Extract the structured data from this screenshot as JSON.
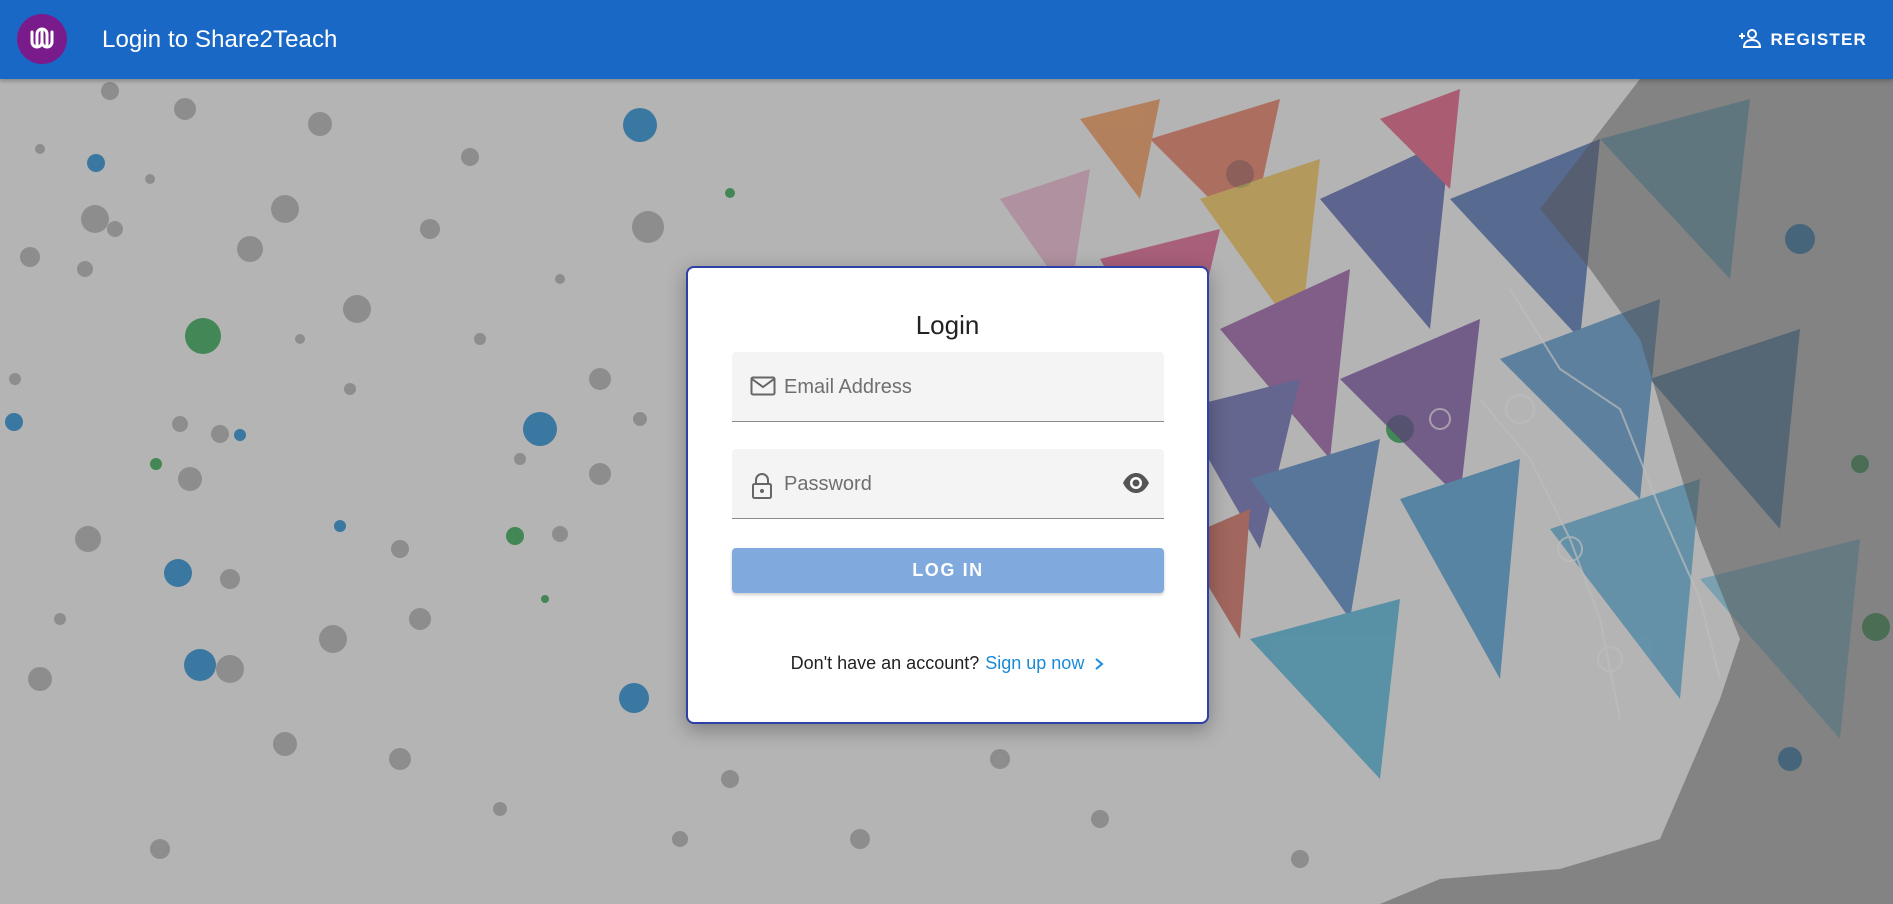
{
  "header": {
    "title": "Login to Share2Teach",
    "register_label": "REGISTER"
  },
  "card": {
    "title": "Login",
    "email_placeholder": "Email Address",
    "password_placeholder": "Password",
    "login_label": "LOG IN",
    "signup_prompt": "Don't have an account?",
    "signup_link": "Sign up now"
  },
  "colors": {
    "appbar": "#1a68c6",
    "logo": "#7a1b8c",
    "login_button": "#80a9de",
    "link": "#1a8ad6",
    "card_border": "#2e3fa8"
  },
  "icons": {
    "logo": "share2teach-logo-icon",
    "register": "person-add-icon",
    "email": "mail-icon",
    "password": "lock-icon",
    "visibility": "eye-icon",
    "signup": "chevron-right-icon"
  }
}
